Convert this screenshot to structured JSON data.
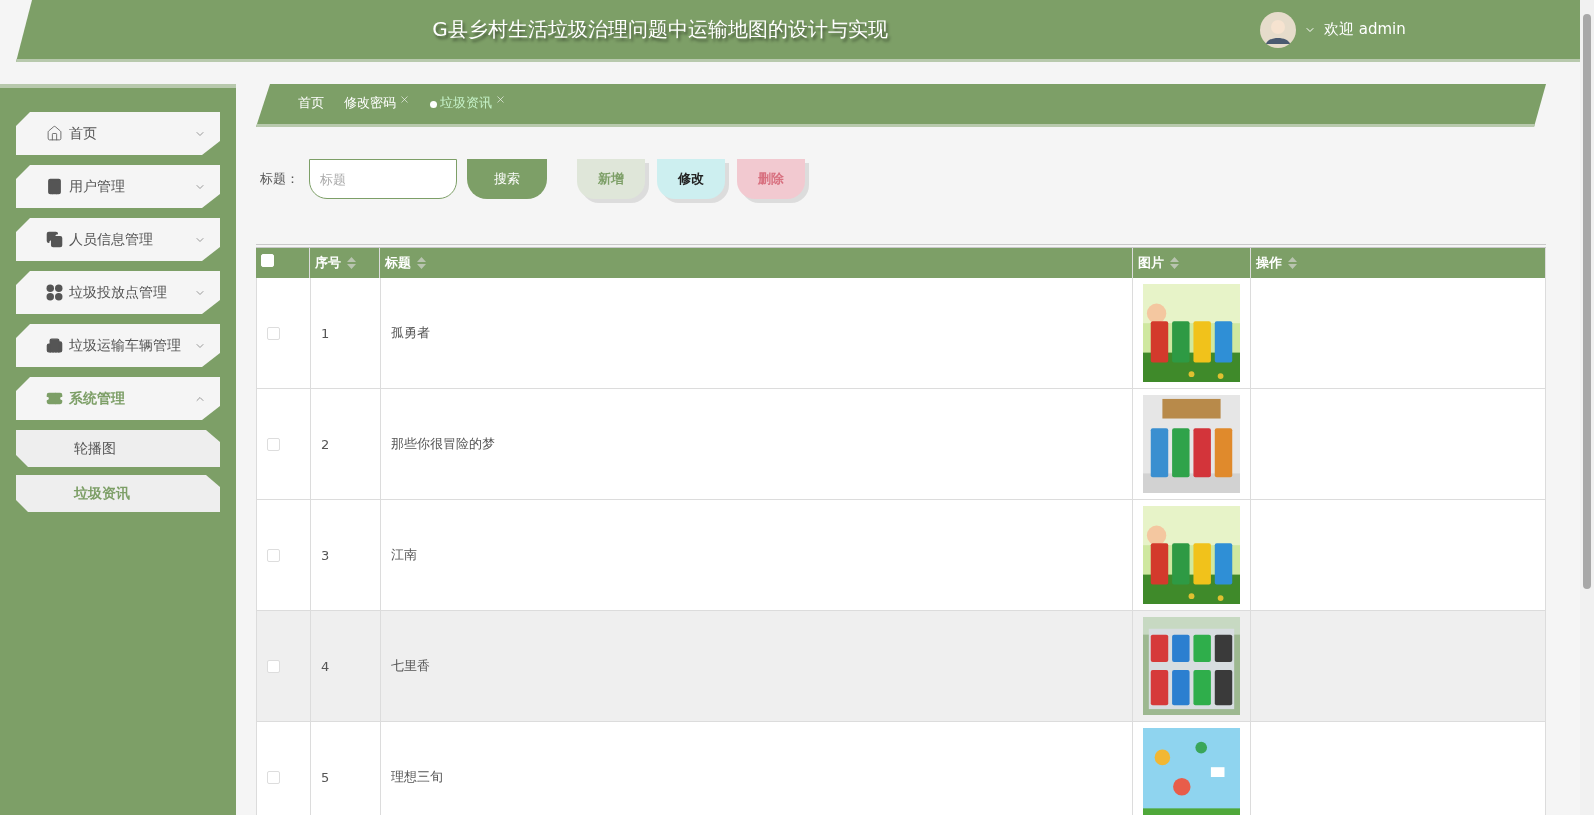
{
  "header": {
    "title": "G县乡村生活垃圾治理问题中运输地图的设计与实现",
    "welcome": "欢迎 admin"
  },
  "sidebar": {
    "items": [
      {
        "label": "首页",
        "expanded": false,
        "selected": false
      },
      {
        "label": "用户管理",
        "expanded": false,
        "selected": false
      },
      {
        "label": "人员信息管理",
        "expanded": false,
        "selected": false
      },
      {
        "label": "垃圾投放点管理",
        "expanded": false,
        "selected": false
      },
      {
        "label": "垃圾运输车辆管理",
        "expanded": false,
        "selected": false
      },
      {
        "label": "系统管理",
        "expanded": true,
        "selected": true,
        "children": [
          {
            "label": "轮播图",
            "selected": false
          },
          {
            "label": "垃圾资讯",
            "selected": true
          }
        ]
      }
    ]
  },
  "tabs": [
    {
      "label": "首页",
      "closable": false,
      "selected": false
    },
    {
      "label": "修改密码",
      "closable": true,
      "selected": false
    },
    {
      "label": "垃圾资讯",
      "closable": true,
      "selected": true
    }
  ],
  "search": {
    "label": "标题：",
    "placeholder": "标题",
    "button": "搜索"
  },
  "actions": [
    {
      "label": "新增",
      "kind": "add"
    },
    {
      "label": "修改",
      "kind": "edit"
    },
    {
      "label": "删除",
      "kind": "delete"
    }
  ],
  "table": {
    "all_checked": false,
    "columns": [
      "序号",
      "标题",
      "图片",
      "操作"
    ],
    "rows": [
      {
        "checked": false,
        "hovered": false,
        "index": "1",
        "title": "孤勇者"
      },
      {
        "checked": false,
        "hovered": false,
        "index": "2",
        "title": "那些你很冒险的梦"
      },
      {
        "checked": false,
        "hovered": false,
        "index": "3",
        "title": "江南"
      },
      {
        "checked": false,
        "hovered": true,
        "index": "4",
        "title": "七里香"
      },
      {
        "checked": false,
        "hovered": false,
        "index": "5",
        "title": "理想三旬"
      }
    ]
  }
}
